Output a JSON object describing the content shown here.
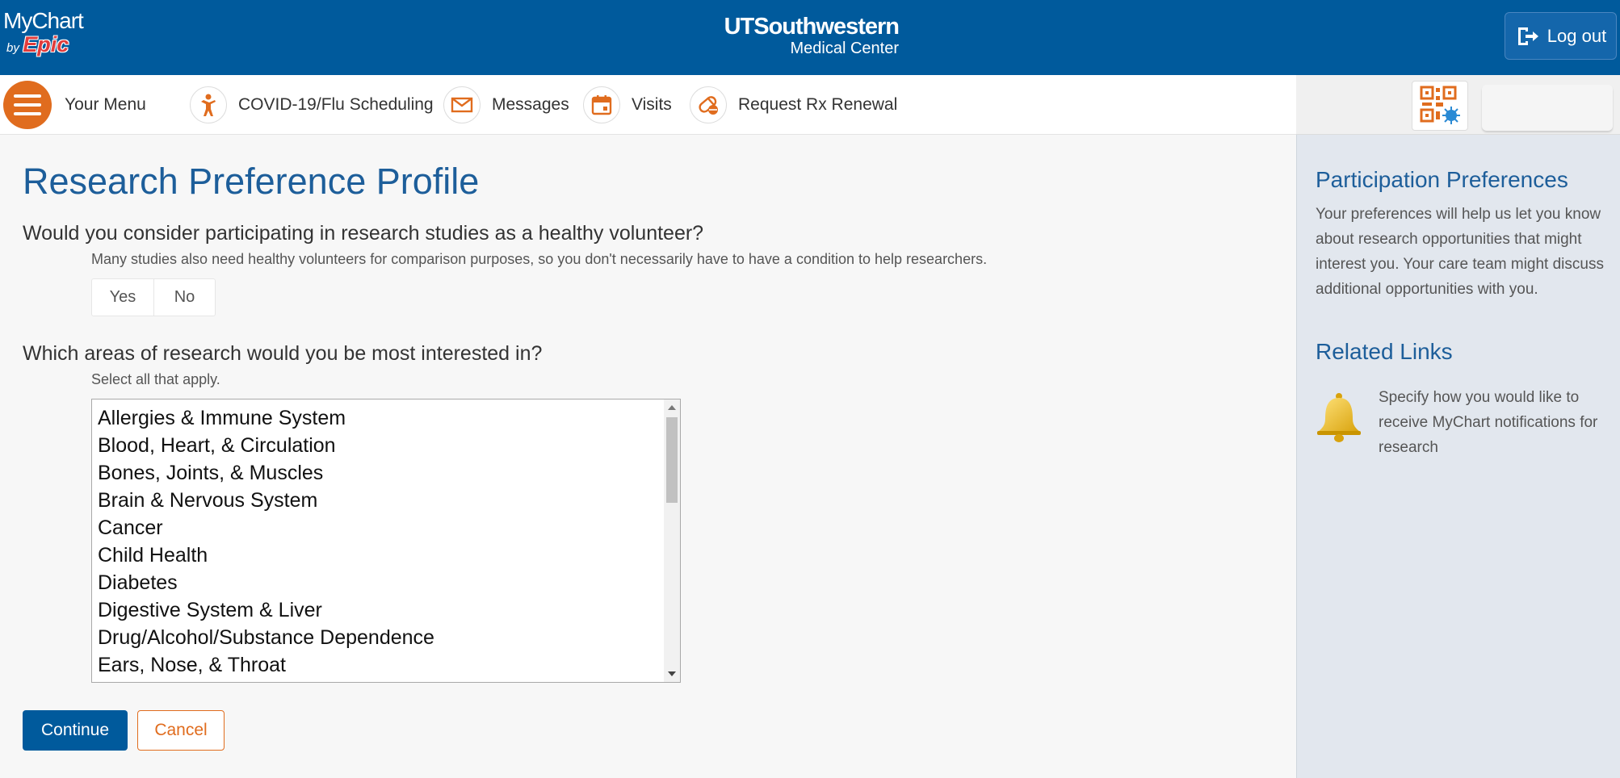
{
  "header": {
    "brand_mychart": "MyChart",
    "brand_by": "by",
    "brand_epic": "Epic",
    "org_name": "UTSouthwestern",
    "org_subtitle": "Medical Center",
    "logout_label": "Log out",
    "bar_color": "#005a9c"
  },
  "nav": {
    "menu_label": "Your Menu",
    "items": [
      {
        "label": "COVID-19/Flu Scheduling",
        "icon": "person-icon"
      },
      {
        "label": "Messages",
        "icon": "envelope-icon"
      },
      {
        "label": "Visits",
        "icon": "calendar-icon"
      },
      {
        "label": "Request Rx Renewal",
        "icon": "pill-icon"
      }
    ],
    "accent_color": "#e06c1e"
  },
  "main": {
    "title": "Research Preference Profile",
    "question1": "Would you consider participating in research studies as a healthy volunteer?",
    "question1_help": "Many studies also need healthy volunteers for comparison purposes, so you don't necessarily have to have a condition to help researchers.",
    "yes_label": "Yes",
    "no_label": "No",
    "question2": "Which areas of research would you be most interested in?",
    "question2_help": "Select all that apply.",
    "research_areas": [
      "Allergies & Immune System",
      "Blood, Heart, & Circulation",
      "Bones, Joints, & Muscles",
      "Brain & Nervous System",
      "Cancer",
      "Child Health",
      "Diabetes",
      "Digestive System & Liver",
      "Drug/Alcohol/Substance Dependence",
      "Ears, Nose, & Throat"
    ],
    "continue_label": "Continue",
    "cancel_label": "Cancel"
  },
  "sidebar": {
    "heading1": "Participation Preferences",
    "text1": "Your preferences will help us let you know about research opportunities that might interest you. Your care team might discuss additional opportunities with you.",
    "heading2": "Related Links",
    "link_text": "Specify how you would like to receive MyChart notifications for research"
  }
}
